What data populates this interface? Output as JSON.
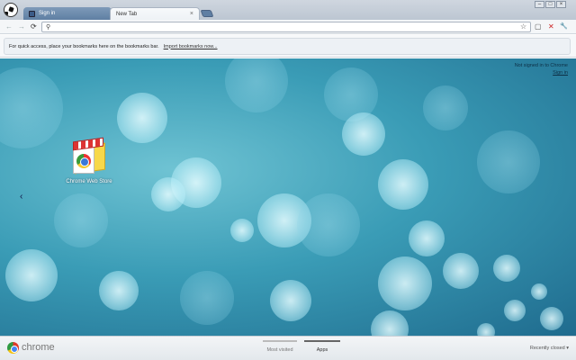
{
  "tabs": [
    {
      "label": "Sign in",
      "active": false
    },
    {
      "label": "New Tab",
      "active": true
    }
  ],
  "window_controls": [
    "–",
    "□",
    "×"
  ],
  "toolbar": {
    "back": "←",
    "forward": "→",
    "reload": "⟳",
    "search_glyph": "⚲",
    "url_value": "",
    "star": "☆",
    "page_menu": "▢",
    "extension": "✕",
    "wrench": "🔧"
  },
  "bookmark_bar": {
    "message": "For quick access, place your bookmarks here on the bookmarks bar.",
    "import_link": "Import bookmarks now..."
  },
  "content": {
    "signin_line1": "Not signed in to Chrome",
    "signin_link": "Sign in",
    "pager_left": "‹",
    "apps": [
      {
        "label": "Chrome Web Store"
      }
    ]
  },
  "footer": {
    "brand": "chrome",
    "most_visited": "Most visited",
    "apps": "Apps",
    "recently_closed": "Recently closed ▾"
  }
}
